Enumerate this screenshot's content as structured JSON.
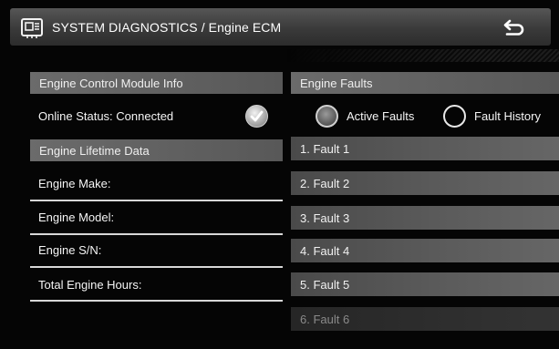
{
  "titlebar": {
    "title": "SYSTEM DIAGNOSTICS / Engine ECM",
    "icon": "ecm-module-icon",
    "back_icon": "back-arrow-icon"
  },
  "left": {
    "ecm_info_header": "Engine Control Module Info",
    "online_status": "Online Status: Connected",
    "online_status_icon": "checkmark-icon",
    "lifetime_header": "Engine Lifetime Data",
    "fields": [
      {
        "label": "Engine Make:"
      },
      {
        "label": "Engine Model:"
      },
      {
        "label": "Engine S/N:"
      },
      {
        "label": "Total Engine Hours:"
      }
    ]
  },
  "right": {
    "faults_header": "Engine Faults",
    "filters": [
      {
        "label": "Active Faults",
        "selected": true
      },
      {
        "label": "Fault History",
        "selected": false
      }
    ],
    "faults": [
      {
        "label": "1. Fault 1"
      },
      {
        "label": "2. Fault 2"
      },
      {
        "label": "3. Fault 3"
      },
      {
        "label": "4. Fault 4"
      },
      {
        "label": "5. Fault 5"
      },
      {
        "label": "6. Fault 6",
        "disabled": true
      }
    ]
  },
  "colors": {
    "background": "#050505",
    "header_bar": "#656565",
    "fault_row": "#555555",
    "text": "#f5f5f5"
  }
}
